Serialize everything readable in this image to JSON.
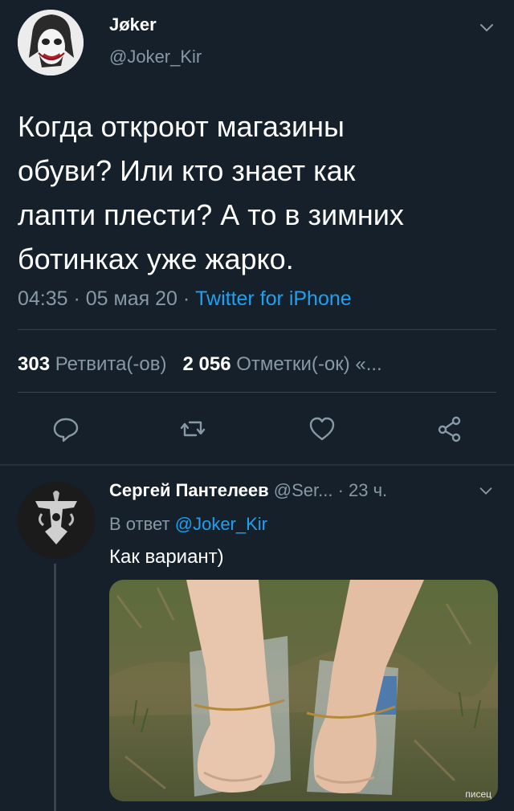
{
  "tweet": {
    "author": {
      "name": "Jøker",
      "handle": "@Joker_Kir"
    },
    "text_lines": [
      "Когда откроют магазины",
      "обуви? Или кто знает как",
      "лапти плести? А то в зимних",
      "ботинках уже жарко."
    ],
    "meta": {
      "time": "04:35",
      "sep1": " · ",
      "date": "05 мая 20",
      "sep2": " · ",
      "source": "Twitter for iPhone"
    },
    "stats": {
      "retweets_count": "303",
      "retweets_label": "Ретвита(-ов)",
      "likes_count": "2 056",
      "likes_label": "Отметки(-ок) «..."
    }
  },
  "reply": {
    "author": {
      "name": "Сергей Пантелеев",
      "handle": "@Ser...",
      "time": "· 23 ч."
    },
    "reply_to_prefix": "В ответ ",
    "reply_to_handle": "@Joker_Kir",
    "text": "Как вариант)"
  },
  "watermark": "писец",
  "icons": {
    "caret": "chevron-down-icon",
    "reply": "comment-icon",
    "retweet": "retweet-icon",
    "like": "heart-icon",
    "share": "share-icon"
  },
  "colors": {
    "background": "#15202b",
    "secondary_text": "#8899a6",
    "link": "#1da1f2",
    "divider": "#38444d"
  }
}
